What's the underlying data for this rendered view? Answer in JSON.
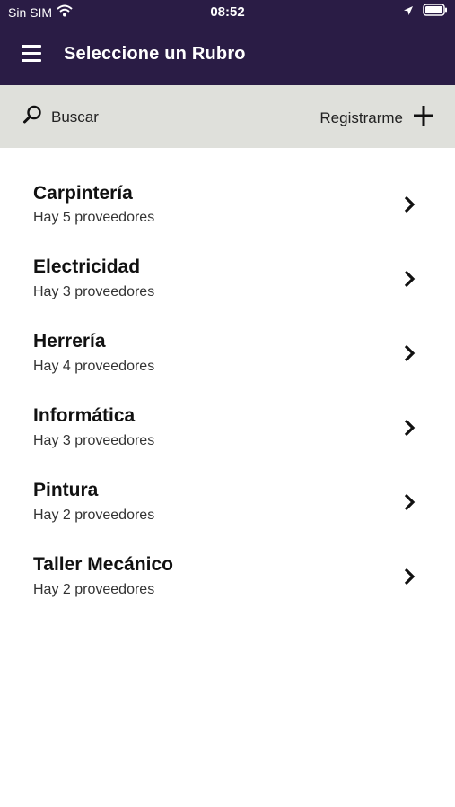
{
  "status_bar": {
    "carrier": "Sin SIM",
    "time": "08:52"
  },
  "app_bar": {
    "title": "Seleccione un Rubro",
    "menu_icon": "hamburger-menu-icon"
  },
  "toolbar": {
    "search_label": "Buscar",
    "search_icon": "search-icon",
    "register_label": "Registrarme",
    "register_icon": "plus-icon"
  },
  "categories": [
    {
      "name": "Carpintería",
      "subtitle": "Hay 5 proveedores"
    },
    {
      "name": "Electricidad",
      "subtitle": "Hay 3 proveedores"
    },
    {
      "name": "Herrería",
      "subtitle": "Hay 4 proveedores"
    },
    {
      "name": "Informática",
      "subtitle": "Hay 3 proveedores"
    },
    {
      "name": "Pintura",
      "subtitle": "Hay 2 proveedores"
    },
    {
      "name": "Taller Mecánico",
      "subtitle": "Hay 2 proveedores"
    }
  ],
  "colors": {
    "header_bg": "#2a1c45",
    "toolbar_bg": "#dfe0db",
    "text_primary": "#111111"
  }
}
